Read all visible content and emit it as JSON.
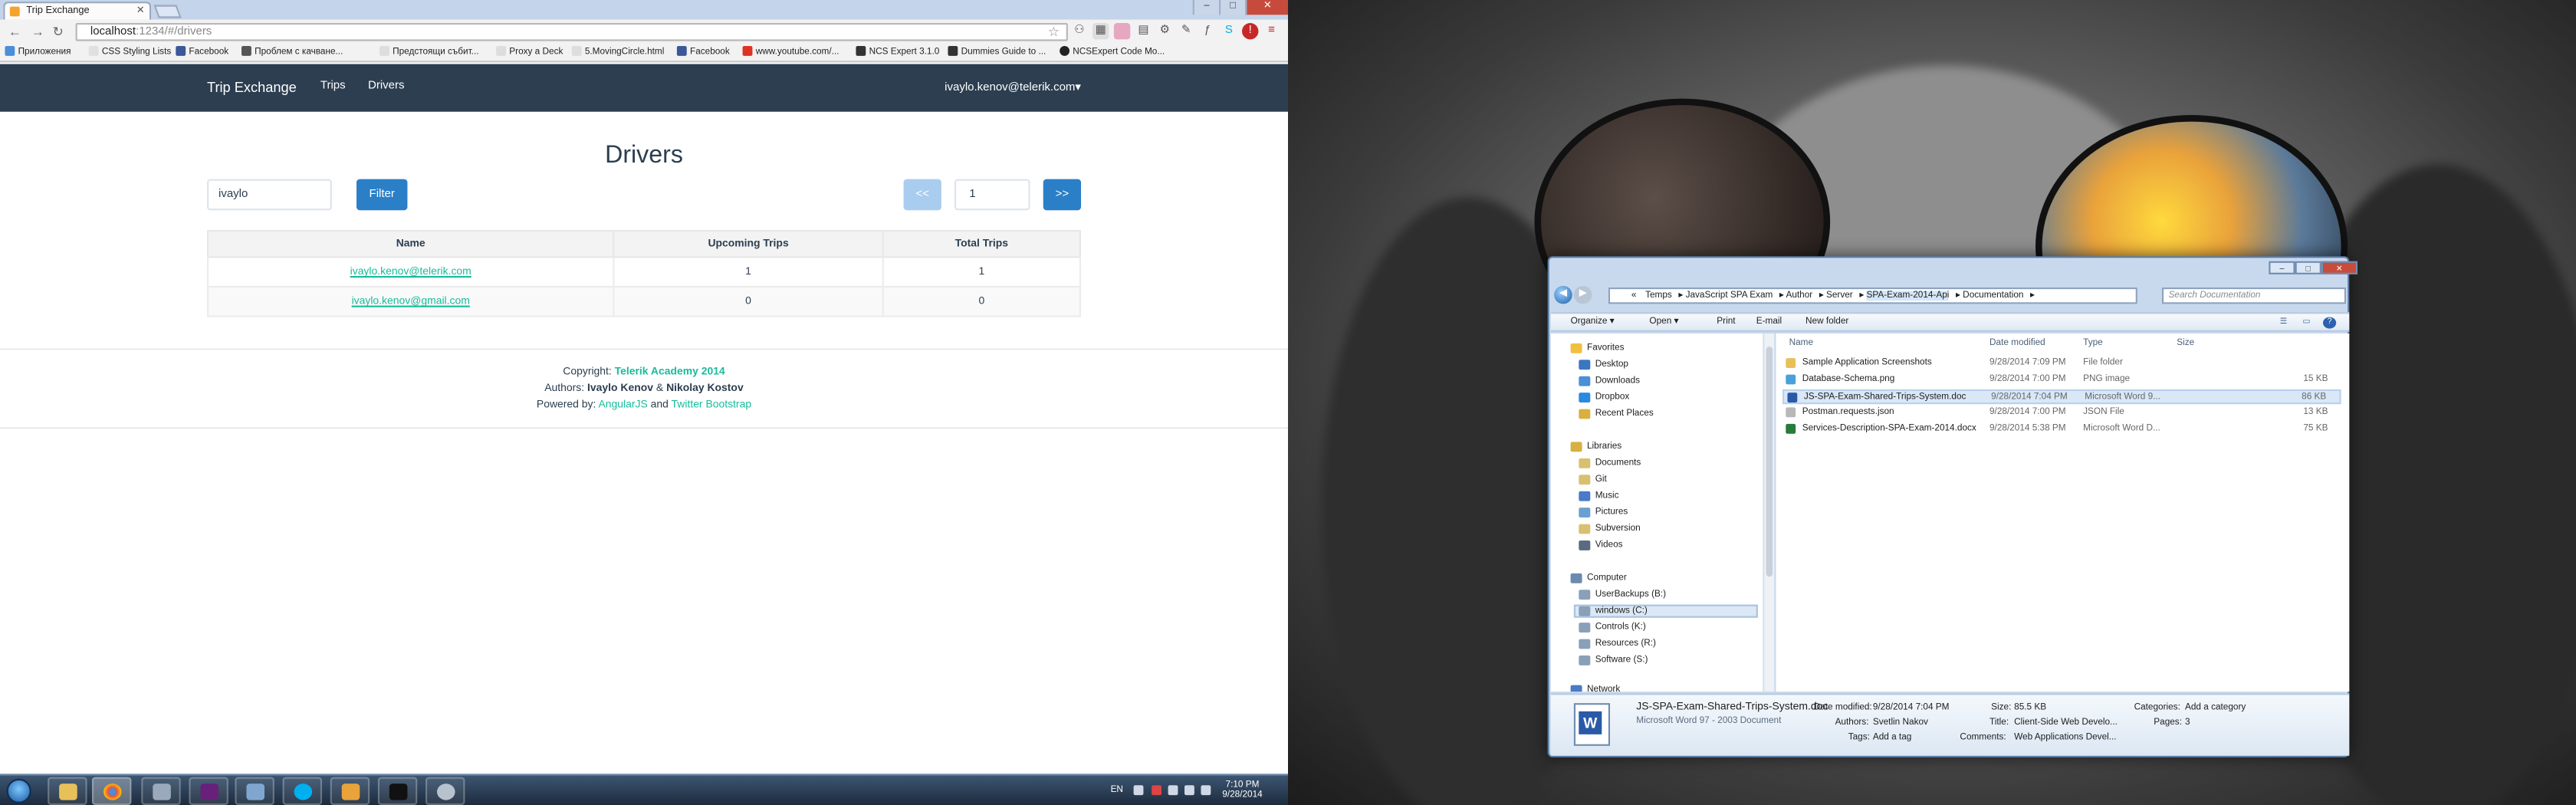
{
  "browser": {
    "tab_title": "Trip Exchange",
    "url_host": "localhost",
    "url_path": ":1234/#/drivers",
    "bookmarks": [
      "Приложения",
      "CSS Styling Lists",
      "Facebook",
      "Проблем с качване...",
      "Предстоящи събит...",
      "Proxy a Deck",
      "5.MovingCircle.html",
      "Facebook",
      "www.youtube.com/...",
      "NCS Expert 3.1.0",
      "Dummies Guide to ...",
      "NCSExpert Code Mo..."
    ]
  },
  "app": {
    "brand": "Trip Exchange",
    "nav": [
      "Trips",
      "Drivers"
    ],
    "user": "ivaylo.kenov@telerik.com",
    "heading": "Drivers",
    "filter_value": "ivaylo",
    "filter_button": "Filter",
    "prev_label": "<<",
    "page_value": "1",
    "next_label": ">>",
    "columns": [
      "Name",
      "Upcoming Trips",
      "Total Trips"
    ],
    "rows": [
      {
        "name": "ivaylo.kenov@telerik.com",
        "upcoming": "1",
        "total": "1"
      },
      {
        "name": "ivaylo.kenov@gmail.com",
        "upcoming": "0",
        "total": "0"
      }
    ],
    "footer": {
      "copyright_label": "Copyright:",
      "copyright_link": "Telerik Academy 2014",
      "authors_label": "Authors:",
      "author1": "Ivaylo Kenov",
      "amp": "&",
      "author2": "Nikolay Kostov",
      "powered_label": "Powered by:",
      "angular": "AngularJS",
      "and": "and",
      "bootstrap": "Twitter Bootstrap"
    }
  },
  "taskbar": {
    "lang": "EN",
    "time": "7:10 PM",
    "date": "9/28/2014"
  },
  "explorer": {
    "breadcrumb": [
      "«",
      "Temps",
      "JavaScript SPA Exam",
      "Author",
      "Server",
      "SPA-Exam-2014-Api",
      "Documentation"
    ],
    "search_placeholder": "Search Documentation",
    "commands": [
      "Organize ▾",
      "Open ▾",
      "Print",
      "E-mail",
      "New folder"
    ],
    "favorites_header": "Favorites",
    "favorites": [
      "Desktop",
      "Downloads",
      "Dropbox",
      "Recent Places"
    ],
    "libraries_header": "Libraries",
    "libraries": [
      "Documents",
      "Git",
      "Music",
      "Pictures",
      "Subversion",
      "Videos"
    ],
    "computer_header": "Computer",
    "drives": [
      "UserBackups (B:)",
      "windows (C:)",
      "Controls (K:)",
      "Resources (R:)",
      "Software (S:)"
    ],
    "network": "Network",
    "columns": [
      "Name",
      "Date modified",
      "Type",
      "Size"
    ],
    "files": [
      {
        "name": "Sample Application Screenshots",
        "date": "9/28/2014 7:09 PM",
        "type": "File folder",
        "size": ""
      },
      {
        "name": "Database-Schema.png",
        "date": "9/28/2014 7:00 PM",
        "type": "PNG image",
        "size": "15 KB"
      },
      {
        "name": "JS-SPA-Exam-Shared-Trips-System.doc",
        "date": "9/28/2014 7:04 PM",
        "type": "Microsoft Word 9...",
        "size": "86 KB"
      },
      {
        "name": "Postman.requests.json",
        "date": "9/28/2014 7:00 PM",
        "type": "JSON File",
        "size": "13 KB"
      },
      {
        "name": "Services-Description-SPA-Exam-2014.docx",
        "date": "9/28/2014 5:38 PM",
        "type": "Microsoft Word D...",
        "size": "75 KB"
      }
    ],
    "details": {
      "filename": "JS-SPA-Exam-Shared-Trips-System.doc",
      "filetype": "Microsoft Word 97 - 2003 Document",
      "date_label": "Date modified:",
      "date": "9/28/2014 7:04 PM",
      "authors_label": "Authors:",
      "authors": "Svetlin Nakov",
      "tags_label": "Tags:",
      "tags": "Add a tag",
      "size_label": "Size:",
      "size": "85.5 KB",
      "title_label": "Title:",
      "title": "Client-Side Web Develo...",
      "comments_label": "Comments:",
      "comments": "Web Applications Devel...",
      "categories_label": "Categories:",
      "categories": "Add a category",
      "pages_label": "Pages:",
      "pages": "3"
    }
  },
  "colors": {
    "navbar": "#2c3e50",
    "accent": "#18bc9c",
    "primary_button": "#2a7fc7"
  }
}
